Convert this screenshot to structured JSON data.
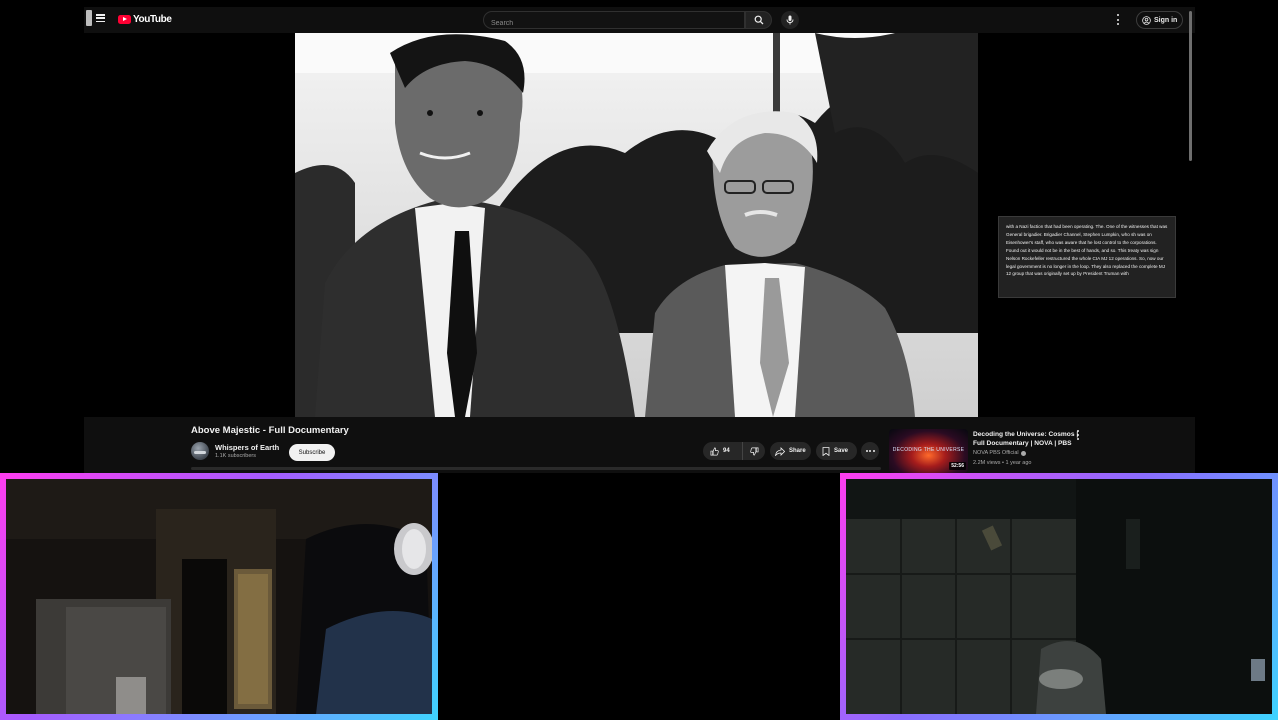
{
  "header": {
    "logo_text": "YouTube",
    "search_placeholder": "Search",
    "sign_in_label": "Sign in",
    "icons": [
      "menu-icon",
      "search-icon",
      "mic-icon",
      "more-vert-icon",
      "account-icon"
    ]
  },
  "player": {
    "transcript_text": "with a Nazi faction that had been operating. The. One of the witnesses that was General brigadier. Brigadier Channel, Stephen Lumpkin, who sh was on Eisenhower's staff, who was aware that he lost control to the corporations. Found out it would not be in the best of hands, and so. This treaty was sign Nelson Rockefeller restructured the whole CIA MJ 12 operations. So, now our legal government is no longer in the loop. They also replaced the complete MJ 12 group that was originally set up by President Truman with"
  },
  "video": {
    "title": "Above Majestic - Full Documentary",
    "channel_name": "Whispers of Earth",
    "subscribers": "1.1K subscribers",
    "subscribe_label": "Subscribe",
    "like_count": "94",
    "share_label": "Share",
    "save_label": "Save"
  },
  "recommended": [
    {
      "title": "Decoding the Universe: Cosmos | Full Documentary | NOVA | PBS",
      "channel": "NOVA PBS Official",
      "meta": "2.2M views • 1 year ago",
      "duration": "52:56",
      "thumb_caption": "DECODING THE UNIVERSE"
    }
  ],
  "colors": {
    "youtube_red": "#ff0033",
    "background": "#0f0f0f",
    "webcam_border_pink": "#ff3df0",
    "webcam_border_cyan": "#3fd4ff"
  }
}
